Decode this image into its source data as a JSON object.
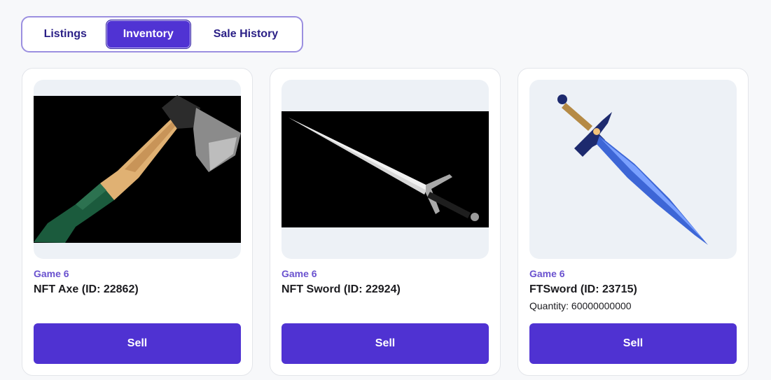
{
  "tabs": [
    {
      "label": "Listings",
      "active": false
    },
    {
      "label": "Inventory",
      "active": true
    },
    {
      "label": "Sale History",
      "active": false
    }
  ],
  "items": [
    {
      "game": "Game 6",
      "name": "NFT Axe (ID: 22862)",
      "quantity": "",
      "action": "Sell",
      "image": "axe-image"
    },
    {
      "game": "Game 6",
      "name": "NFT Sword (ID: 22924)",
      "quantity": "",
      "action": "Sell",
      "image": "sword-image"
    },
    {
      "game": "Game 6",
      "name": "FTSword (ID: 23715)",
      "quantity": "Quantity: 60000000000",
      "action": "Sell",
      "image": "blue-sword-image"
    }
  ],
  "colors": {
    "accent": "#4f32d2",
    "accent_text": "#6a52cf",
    "tab_border": "#9b8fe0",
    "media_bg": "#edf1f6"
  }
}
